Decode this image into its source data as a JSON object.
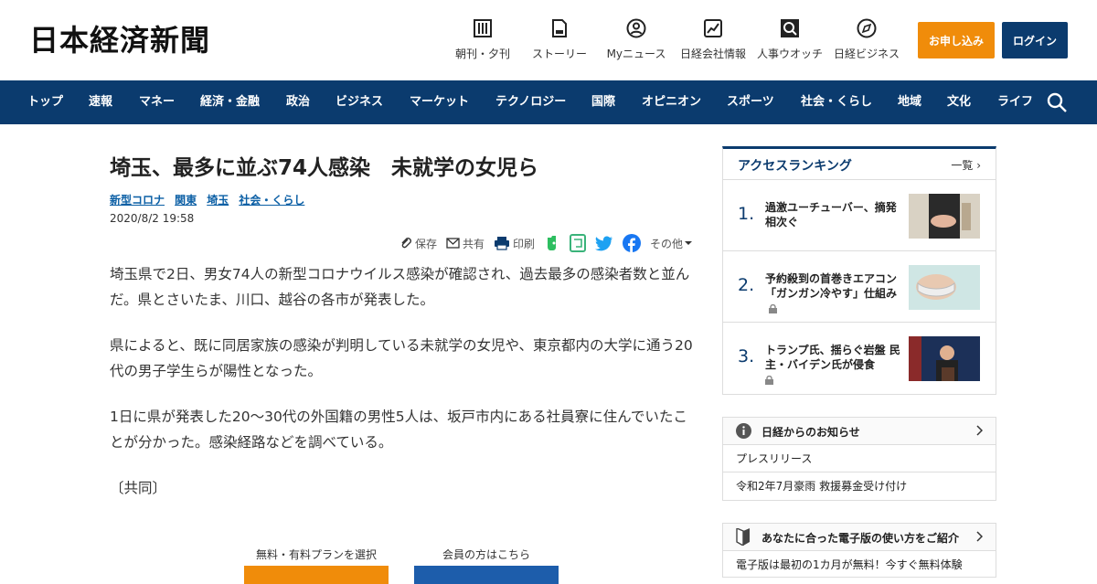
{
  "header": {
    "logo": "日本経済新聞",
    "nav": [
      {
        "label": "朝刊・夕刊",
        "icon": "newspaper-icon"
      },
      {
        "label": "ストーリー",
        "icon": "document-icon"
      },
      {
        "label": "Myニュース",
        "icon": "user-icon"
      },
      {
        "label": "日経会社情報",
        "icon": "chart-icon"
      },
      {
        "label": "人事ウオッチ",
        "icon": "search-person-icon"
      },
      {
        "label": "日経ビジネス",
        "icon": "compass-icon"
      }
    ],
    "apply_label": "お申し込み",
    "login_label": "ログイン"
  },
  "navbar": {
    "items": [
      "トップ",
      "速報",
      "マネー",
      "経済・金融",
      "政治",
      "ビジネス",
      "マーケット",
      "テクノロジー",
      "国際",
      "オピニオン",
      "スポーツ",
      "社会・くらし",
      "地域",
      "文化",
      "ライフ"
    ]
  },
  "article": {
    "title": "埼玉、最多に並ぶ74人感染　未就学の女児ら",
    "tags": [
      "新型コロナ",
      "関東",
      "埼玉",
      "社会・くらし"
    ],
    "date": "2020/8/2 19:58",
    "share": {
      "save": "保存",
      "share": "共有",
      "print": "印刷",
      "other": "その他"
    },
    "paragraphs": [
      "埼玉県で2日、男女74人の新型コロナウイルス感染が確認され、過去最多の感染者数と並んだ。県とさいたま、川口、越谷の各市が発表した。",
      "県によると、既に同居家族の感染が判明している未就学の女児や、東京都内の大学に通う20代の男子学生らが陽性となった。",
      "1日に県が発表した20～30代の外国籍の男性5人は、坂戸市内にある社員寮に住んでいたことが分かった。感染経路などを調べている。",
      "〔共同〕"
    ],
    "cta": {
      "plan_label": "無料・有料プランを選択",
      "member_label": "会員の方はこちら"
    }
  },
  "ranking": {
    "title": "アクセスランキング",
    "more": "一覧",
    "items": [
      {
        "rank": "1.",
        "text": "過激ユーチューバー、摘発相次ぐ",
        "locked": false
      },
      {
        "rank": "2.",
        "text": "予約殺到の首巻きエアコン 「ガンガン冷やす」仕組み",
        "locked": true
      },
      {
        "rank": "3.",
        "text": "トランプ氏、揺らぐ岩盤 民主・バイデン氏が侵食",
        "locked": true
      }
    ]
  },
  "notice": {
    "title": "日経からのお知らせ",
    "rows": [
      "プレスリリース",
      "令和2年7月豪雨 救援募金受け付け"
    ]
  },
  "guide": {
    "title": "あなたに合った電子版の使い方をご紹介",
    "rows": [
      "電子版は最初の1カ月が無料！今すぐ無料体験"
    ]
  },
  "colors": {
    "brand": "#0b3b6e",
    "accent": "#f08c0a",
    "link": "#0b5fa5"
  }
}
